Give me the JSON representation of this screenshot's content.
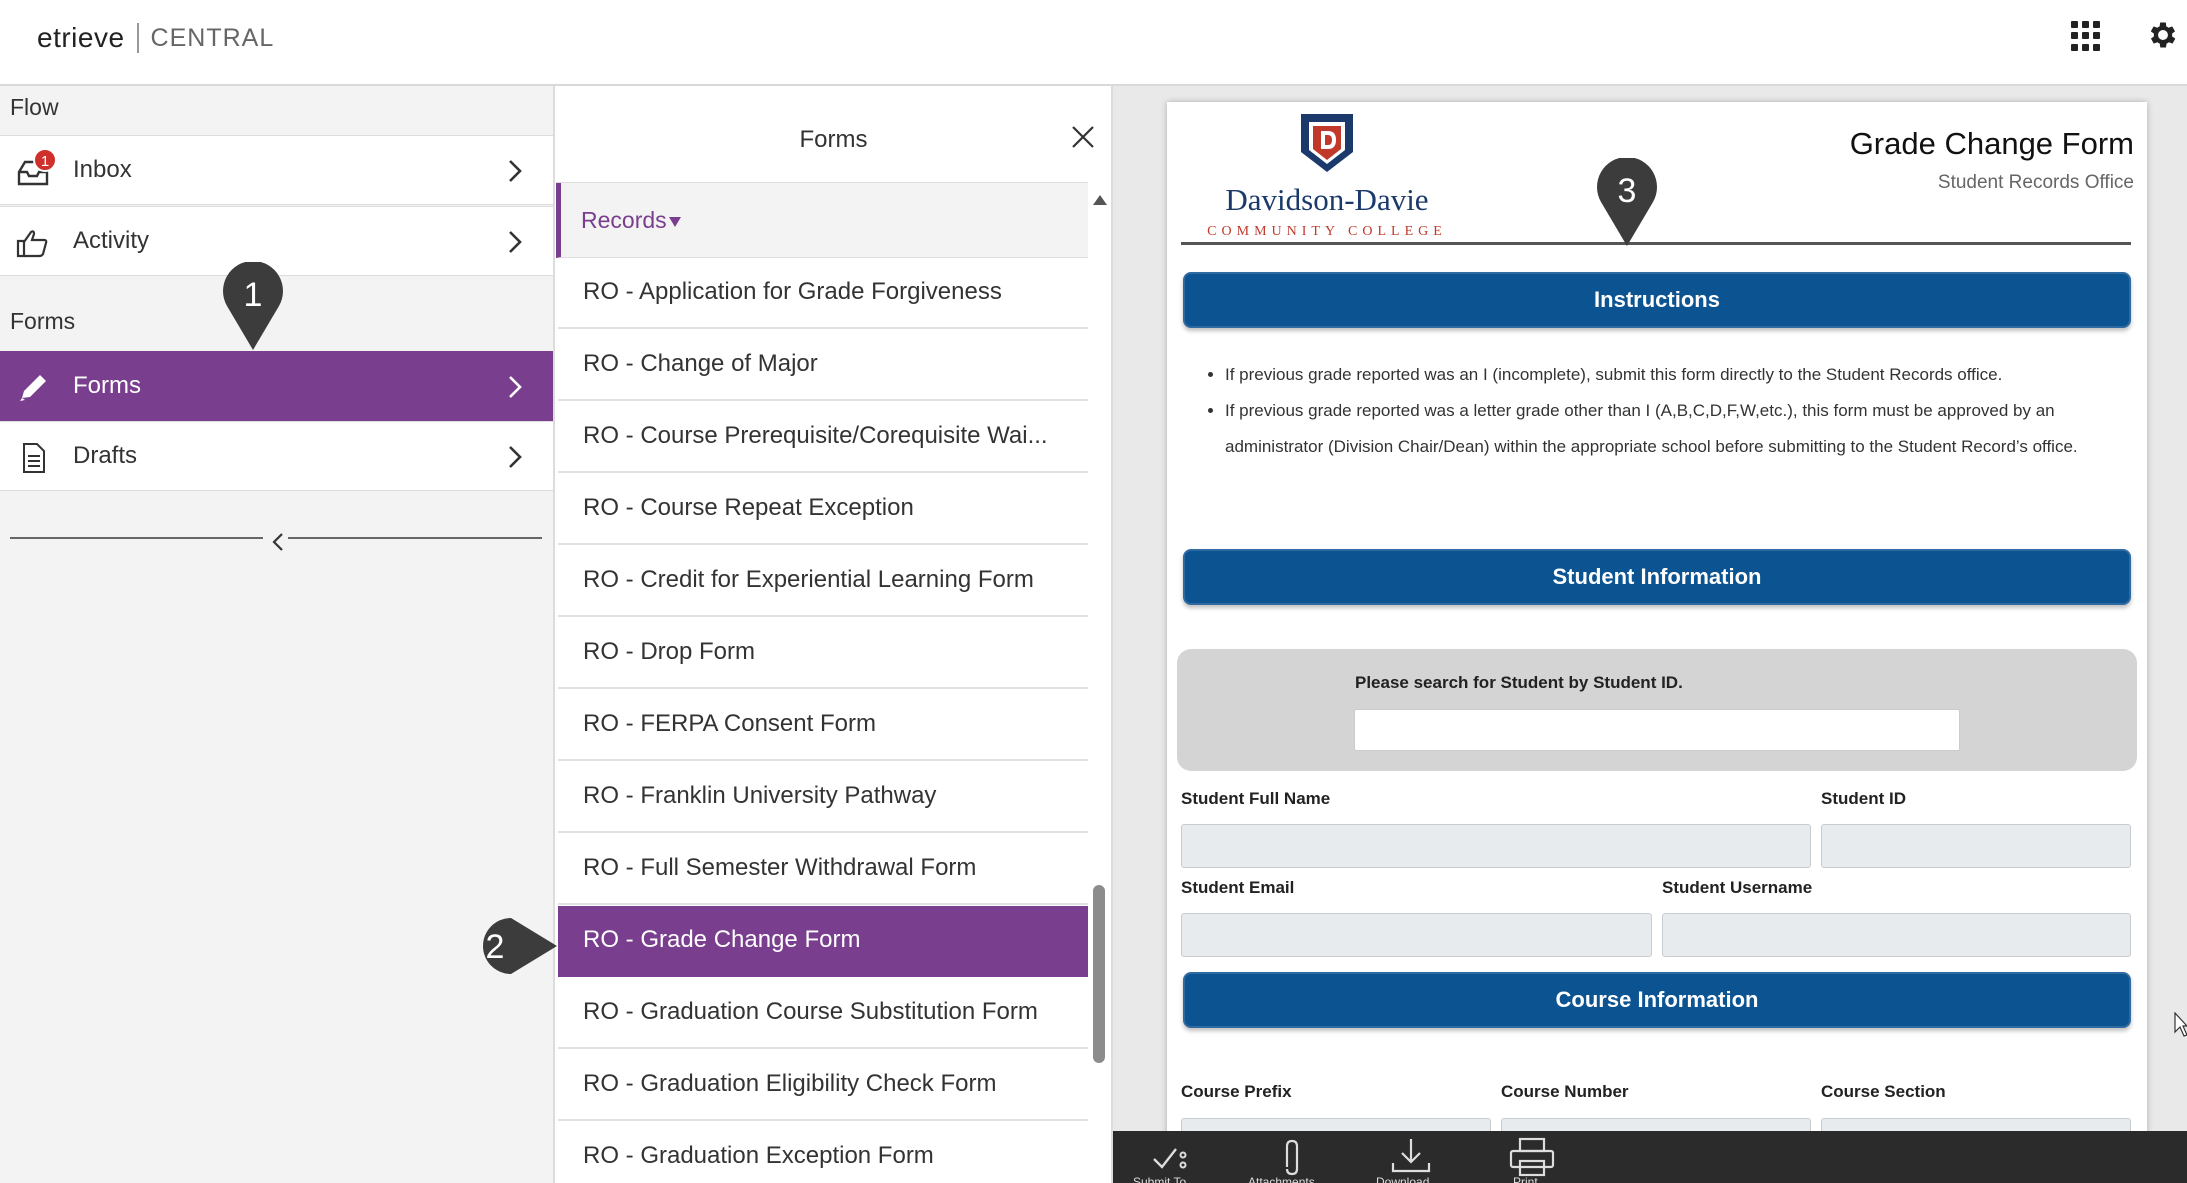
{
  "header": {
    "brand": "etrieve",
    "product": "CENTRAL"
  },
  "sidebar": {
    "flow_label": "Flow",
    "forms_label": "Forms",
    "flow_items": [
      {
        "label": "Inbox",
        "badge": "1",
        "icon": "inbox-icon"
      },
      {
        "label": "Activity",
        "icon": "thumbs-up-icon"
      }
    ],
    "forms_items": [
      {
        "label": "Forms",
        "icon": "pencil-icon",
        "active": true
      },
      {
        "label": "Drafts",
        "icon": "document-icon"
      }
    ]
  },
  "forms_panel": {
    "title": "Forms",
    "category": "Records",
    "items": [
      "RO - Application for Grade Forgiveness",
      "RO - Change of Major",
      "RO - Course Prerequisite/Corequisite Wai...",
      "RO - Course Repeat Exception",
      "RO - Credit for Experiential Learning Form",
      "RO - Drop Form",
      "RO - FERPA Consent Form",
      "RO - Franklin University Pathway",
      "RO - Full Semester Withdrawal Form",
      "RO - Grade Change Form",
      "RO - Graduation Course Substitution Form",
      "RO - Graduation Eligibility Check Form",
      "RO - Graduation Exception Form"
    ],
    "selected_index": 9
  },
  "document": {
    "college_name": "Davidson-Davie",
    "college_sub": "COMMUNITY COLLEGE",
    "title": "Grade Change Form",
    "subtitle": "Student Records Office",
    "sections": {
      "instructions": "Instructions",
      "student_info": "Student Information",
      "course_info": "Course Information"
    },
    "instructions": [
      "If previous grade reported was an I (incomplete), submit this form directly to the Student Records office.",
      "If previous grade reported was a letter grade other than I (A,B,C,D,F,W,etc.), this form must be approved by an administrator (Division Chair/Dean) within the appropriate school before submitting to the Student Record’s office."
    ],
    "search_label": "Please search for Student by Student ID.",
    "fields": {
      "full_name": "Student Full Name",
      "student_id": "Student ID",
      "email": "Student Email",
      "username": "Student Username",
      "course_prefix": "Course Prefix",
      "course_number": "Course Number",
      "course_section": "Course Section"
    }
  },
  "toolbar": {
    "items": [
      "Submit To...",
      "Attachments",
      "Download",
      "Print"
    ]
  },
  "markers": [
    "1",
    "2",
    "3"
  ],
  "colors": {
    "accent_purple": "#7a3e8e",
    "section_blue": "#0b5391",
    "badge_red": "#d0302b",
    "marker_gray": "#3c3c3c"
  }
}
